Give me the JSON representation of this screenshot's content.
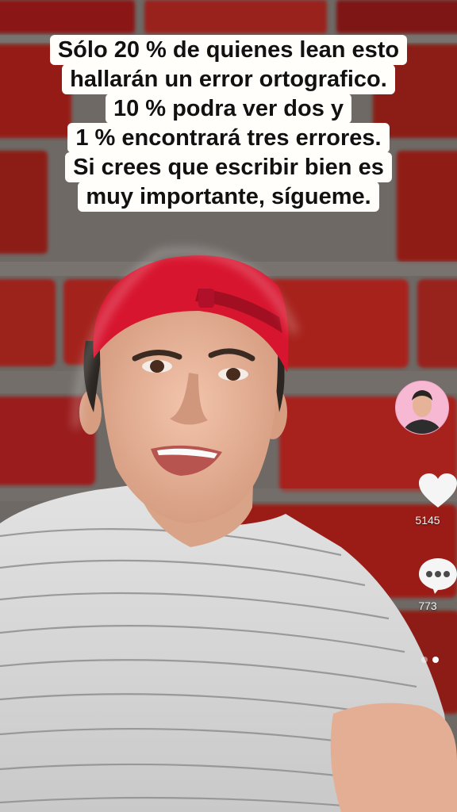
{
  "caption": {
    "lines": [
      "Sólo 20 % de quienes lean esto",
      "hallarán un error ortografico.",
      "10 % podra ver dos y",
      "1 % encontrará tres errores.",
      "Si crees que escribir bien es",
      "muy importante, sígueme."
    ]
  },
  "sidebar": {
    "avatar_icon": "creator-avatar",
    "like_icon": "heart-icon",
    "like_count": "5145",
    "comment_icon": "comment-bubble-icon",
    "comment_count": "773"
  },
  "pager": {
    "total": 2,
    "active_index": 1
  },
  "colors": {
    "brick": "#8f1a16",
    "mortar": "#6e6965",
    "cap": "#d8152f",
    "shirt": "#dcdcdc",
    "skin": "#e8b69b",
    "avatar_bg": "#f6b8d3"
  }
}
